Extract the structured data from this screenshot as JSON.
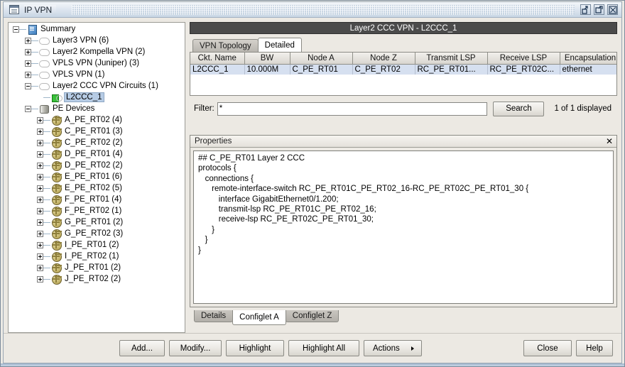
{
  "window": {
    "title": "IP VPN",
    "icon": "window-app-icon",
    "buttons": [
      {
        "name": "minimize-button",
        "glyph": "restore-down-icon"
      },
      {
        "name": "maximize-button",
        "glyph": "maximize-icon"
      },
      {
        "name": "close-button",
        "glyph": "close-icon"
      }
    ]
  },
  "tree": {
    "nodes": [
      {
        "label": "Summary",
        "depth": 0,
        "state": "expanded",
        "icon": "summary-icon",
        "selected": false
      },
      {
        "label": "Layer3 VPN (6)",
        "depth": 1,
        "state": "collapsed",
        "icon": "cloud-icon",
        "selected": false
      },
      {
        "label": "Layer2 Kompella VPN (2)",
        "depth": 1,
        "state": "collapsed",
        "icon": "cloud-icon",
        "selected": false
      },
      {
        "label": "VPLS VPN (Juniper) (3)",
        "depth": 1,
        "state": "collapsed",
        "icon": "cloud-icon",
        "selected": false
      },
      {
        "label": "VPLS VPN (1)",
        "depth": 1,
        "state": "collapsed",
        "icon": "cloud-icon",
        "selected": false
      },
      {
        "label": "Layer2 CCC VPN Circuits (1)",
        "depth": 1,
        "state": "expanded",
        "icon": "cloud-icon",
        "selected": false
      },
      {
        "label": "L2CCC_1",
        "depth": 2,
        "state": "leaf",
        "icon": "vpn-circuit-icon",
        "selected": true
      },
      {
        "label": "PE Devices",
        "depth": 1,
        "state": "expanded",
        "icon": "device-group-icon",
        "selected": false
      },
      {
        "label": "A_PE_RT02 (4)",
        "depth": 2,
        "state": "collapsed",
        "icon": "router-icon",
        "selected": false
      },
      {
        "label": "C_PE_RT01 (3)",
        "depth": 2,
        "state": "collapsed",
        "icon": "router-icon",
        "selected": false
      },
      {
        "label": "C_PE_RT02 (2)",
        "depth": 2,
        "state": "collapsed",
        "icon": "router-icon",
        "selected": false
      },
      {
        "label": "D_PE_RT01 (4)",
        "depth": 2,
        "state": "collapsed",
        "icon": "router-icon",
        "selected": false
      },
      {
        "label": "D_PE_RT02 (2)",
        "depth": 2,
        "state": "collapsed",
        "icon": "router-icon",
        "selected": false
      },
      {
        "label": "E_PE_RT01 (6)",
        "depth": 2,
        "state": "collapsed",
        "icon": "router-icon",
        "selected": false
      },
      {
        "label": "E_PE_RT02 (5)",
        "depth": 2,
        "state": "collapsed",
        "icon": "router-icon",
        "selected": false
      },
      {
        "label": "F_PE_RT01 (4)",
        "depth": 2,
        "state": "collapsed",
        "icon": "router-icon",
        "selected": false
      },
      {
        "label": "F_PE_RT02 (1)",
        "depth": 2,
        "state": "collapsed",
        "icon": "router-icon",
        "selected": false
      },
      {
        "label": "G_PE_RT01 (2)",
        "depth": 2,
        "state": "collapsed",
        "icon": "router-icon",
        "selected": false
      },
      {
        "label": "G_PE_RT02 (3)",
        "depth": 2,
        "state": "collapsed",
        "icon": "router-icon",
        "selected": false
      },
      {
        "label": "I_PE_RT01 (2)",
        "depth": 2,
        "state": "collapsed",
        "icon": "router-icon",
        "selected": false
      },
      {
        "label": "I_PE_RT02 (1)",
        "depth": 2,
        "state": "collapsed",
        "icon": "router-icon",
        "selected": false
      },
      {
        "label": "J_PE_RT01 (2)",
        "depth": 2,
        "state": "collapsed",
        "icon": "router-icon",
        "selected": false
      },
      {
        "label": "J_PE_RT02 (2)",
        "depth": 2,
        "state": "collapsed",
        "icon": "router-icon",
        "selected": false
      }
    ]
  },
  "panel": {
    "title": "Layer2 CCC VPN - L2CCC_1",
    "tabs": [
      {
        "label": "VPN Topology",
        "active": false
      },
      {
        "label": "Detailed",
        "active": true
      }
    ],
    "table": {
      "columns": [
        "Ckt. Name",
        "BW",
        "Node A",
        "Node Z",
        "Transmit LSP",
        "Receive LSP",
        "Encapsulation"
      ],
      "rows": [
        [
          "L2CCC_1",
          "10.000M",
          "C_PE_RT01",
          "C_PE_RT02",
          "RC_PE_RT01...",
          "RC_PE_RT02C...",
          "ethernet"
        ]
      ]
    },
    "filter": {
      "label": "Filter:",
      "value": "*",
      "placeholder": "",
      "search_label": "Search",
      "count_label": "1 of 1 displayed"
    },
    "properties": {
      "header": "Properties",
      "close_glyph": "✕",
      "config_text": "## C_PE_RT01 Layer 2 CCC\nprotocols {\n   connections {\n      remote-interface-switch RC_PE_RT01C_PE_RT02_16-RC_PE_RT02C_PE_RT01_30 {\n         interface GigabitEthernet0/1.200;\n         transmit-lsp RC_PE_RT01C_PE_RT02_16;\n         receive-lsp RC_PE_RT02C_PE_RT01_30;\n      }\n   }\n}"
    },
    "bottom_tabs": [
      {
        "label": "Details",
        "active": false
      },
      {
        "label": "Configlet A",
        "active": true
      },
      {
        "label": "Configlet Z",
        "active": false
      }
    ]
  },
  "button_bar": {
    "left": [
      {
        "label": "Add...",
        "name": "add-button",
        "width_class": "w-add"
      },
      {
        "label": "Modify...",
        "name": "modify-button",
        "width_class": "w-modify"
      },
      {
        "label": "Highlight",
        "name": "highlight-button",
        "width_class": "w-highlight"
      },
      {
        "label": "Highlight All",
        "name": "highlight-all-button",
        "width_class": "w-highlightall"
      },
      {
        "label": "Actions",
        "name": "actions-button",
        "width_class": "w-actions",
        "has_arrow": true
      }
    ],
    "right": [
      {
        "label": "Close",
        "name": "close-button",
        "width_class": "w-close"
      },
      {
        "label": "Help",
        "name": "help-button",
        "width_class": "w-help"
      }
    ]
  },
  "colors": {
    "title_bar": "#cdd9e6",
    "panel_title_bg": "#4b4b4b",
    "row_selected": "#d6e0f0",
    "tree_selection": "#b6cbe4"
  }
}
